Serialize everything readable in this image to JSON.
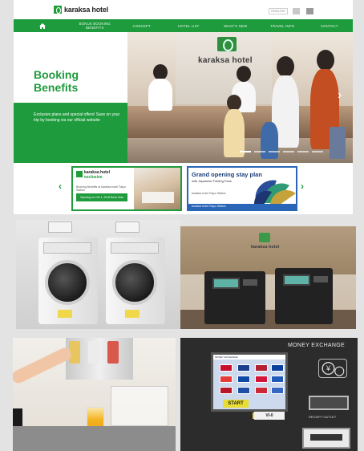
{
  "site": {
    "brand": "karaksa hotel",
    "lang": "ENGLISH",
    "nav": {
      "items": [
        "BONUS BOOKING BENEFITS",
        "CONCEPT",
        "HOTEL LIST",
        "WHAT'S NEW",
        "TRAVEL INFO",
        "CONTACT"
      ]
    },
    "hero": {
      "title": "Booking Benefits",
      "description": "Exclusive plans and special offers! Save on your trip by booking via our official website",
      "sign_text": "karaksa hotel"
    },
    "banners": [
      {
        "brand": "karaksa hotel",
        "badge": "exclusive",
        "description": "Booking Benefits at karaksa hotel Tokyo Station",
        "button": "Opening on Oct 1, 2018 Book Now"
      },
      {
        "title": "Grand opening stay plan",
        "subtitle": "with Japanese Folding Fans",
        "description": "karaksa hotel Tokyo Station",
        "footer": "karaksa hotel Tokyo Station"
      }
    ]
  },
  "photos": {
    "checkin_logo_text": "karaksa hotel",
    "money_exchange": {
      "title": "MONEY EXCHANGE",
      "screen_header": "MONEY EXCHANGE",
      "start_label": "START",
      "receipt_label": "RECEIPT OUTLET",
      "tag_label": "VI-0"
    }
  },
  "colors": {
    "brand_green": "#1e9b3c",
    "banner_blue": "#2a66b8"
  },
  "icons": [
    "home-icon",
    "chevron-left-icon",
    "chevron-right-icon"
  ]
}
